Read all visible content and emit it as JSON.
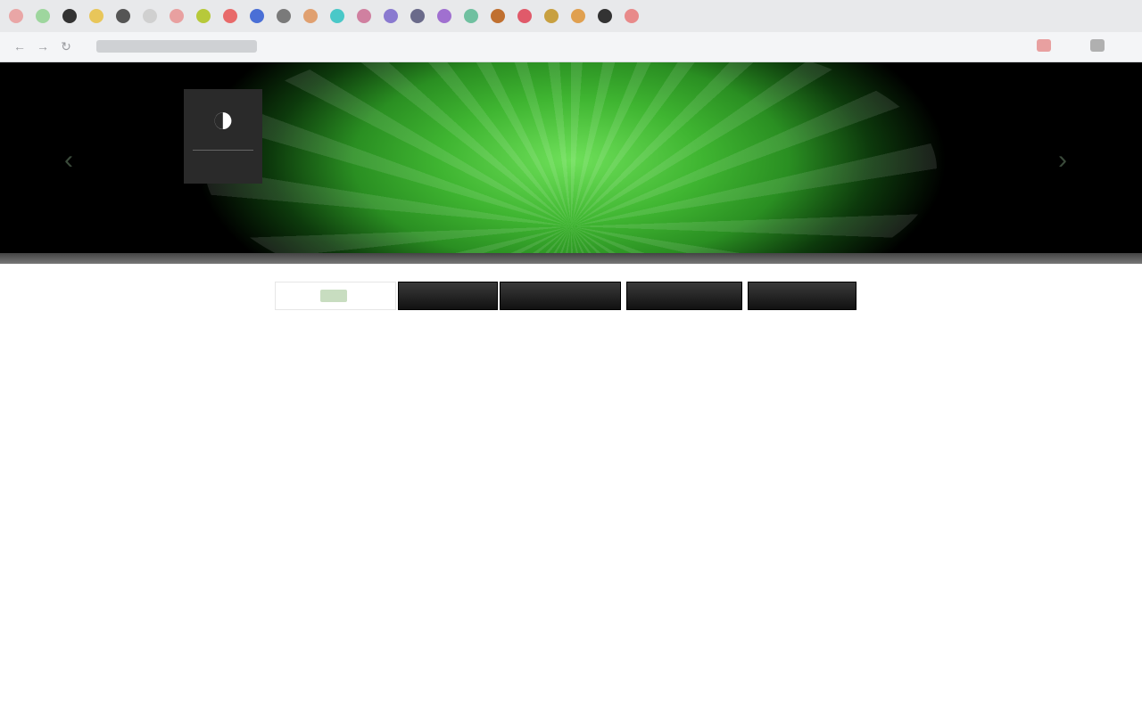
{
  "browser": {
    "tab_colors": [
      "#e9a6a6",
      "#9ed69e",
      "#333333",
      "#e8c65a",
      "#555555",
      "#d0d0d0",
      "#e8a0a0",
      "#b7c93a",
      "#e86a6a",
      "#4a6fd6",
      "#7a7a7a",
      "#e0a070",
      "#4ac8c8",
      "#d080a0",
      "#8a7ad0",
      "#6a6a8a",
      "#a070d0",
      "#70c0a0",
      "#c07030",
      "#e05a6a",
      "#c8a040",
      "#e0a050",
      "#333333",
      "#e88a8a"
    ],
    "url_icon_colors": [
      "#e8a0a0",
      "#b0b0b0"
    ],
    "icons": [
      "back-arrow-icon",
      "forward-arrow-icon",
      "reload-icon"
    ]
  },
  "hero": {
    "prev_icon": "‹",
    "next_icon": "›",
    "logo_glyph": "◑",
    "title": "",
    "subtitle": ""
  },
  "menu": {
    "items": [
      "",
      "",
      "",
      ""
    ]
  },
  "content": {
    "paragraph1": "",
    "paragraph2": "",
    "heading": ""
  },
  "colors": {
    "accent_green": "#3fb531",
    "menu_dark": "#1a1a1a",
    "text_gray": "#505050"
  }
}
